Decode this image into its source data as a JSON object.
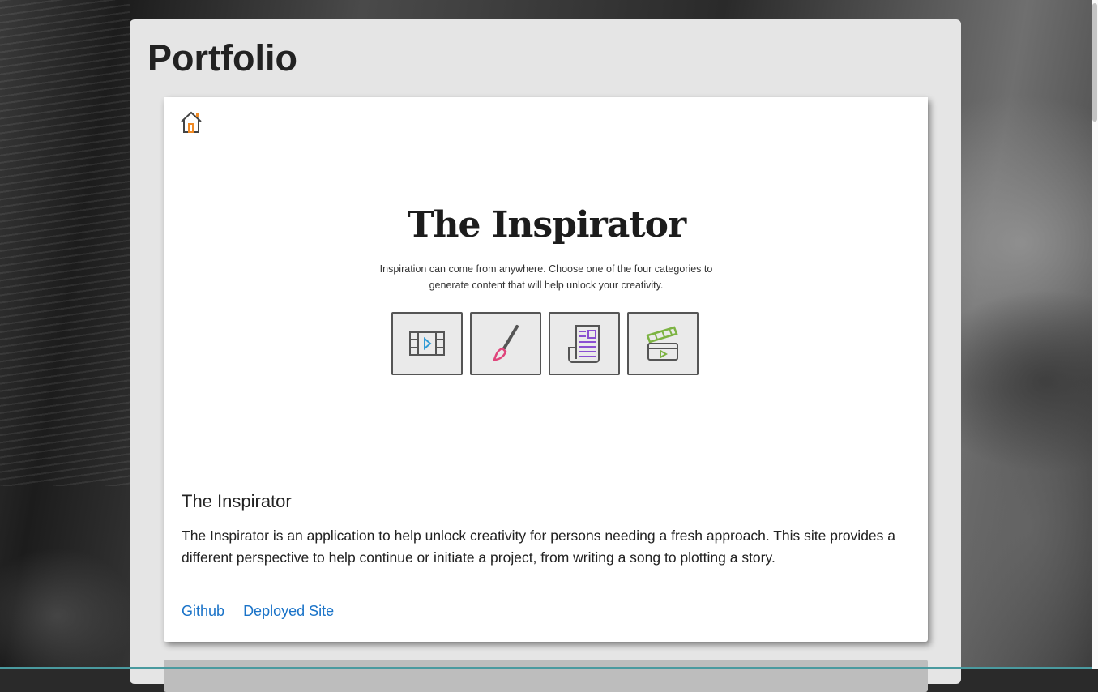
{
  "page": {
    "title": "Portfolio"
  },
  "project": {
    "screenshot": {
      "heading": "The Inspirator",
      "subtitle": "Inspiration can come from anywhere. Choose one of the four categories to generate content that will help unlock your creativity.",
      "categories": [
        {
          "icon": "film-icon",
          "color": "#2f9bd6"
        },
        {
          "icon": "paintbrush-icon",
          "color": "#e0457b"
        },
        {
          "icon": "newspaper-icon",
          "color": "#8a4fd1"
        },
        {
          "icon": "clapperboard-icon",
          "color": "#7cb342"
        }
      ]
    },
    "title": "The Inspirator",
    "description": "The Inspirator is an application to help unlock creativity for persons needing a fresh approach. This site provides a different perspective to help continue or initiate a project, from writing a song to plotting a story.",
    "links": {
      "github": "Github",
      "deployed": "Deployed Site"
    }
  },
  "colors": {
    "link": "#1a73c8",
    "panel": "#e5e5e5"
  }
}
